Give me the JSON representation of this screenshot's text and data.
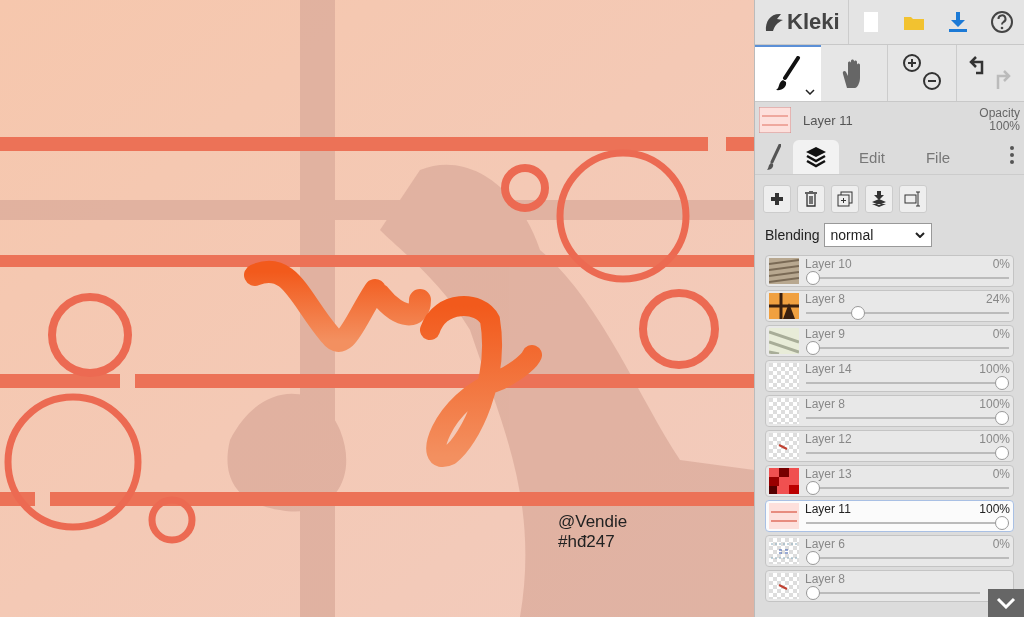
{
  "canvas": {
    "signature": "@Vendie",
    "tag": "#hđ247"
  },
  "app": {
    "name": "Kleki"
  },
  "tools": [
    {
      "kind": "brush",
      "selected": true
    },
    {
      "kind": "hand",
      "selected": false
    }
  ],
  "current_layer": {
    "name": "Layer 11",
    "opacity_label": "Opacity",
    "opacity": "100%"
  },
  "tabs": [
    {
      "kind": "brush",
      "selected": false
    },
    {
      "kind": "layers",
      "selected": true
    },
    {
      "kind": "text",
      "label": "Edit",
      "selected": false
    },
    {
      "kind": "text",
      "label": "File",
      "selected": false
    }
  ],
  "blending": {
    "label": "Blending",
    "value": "normal"
  },
  "layers": [
    {
      "name": "Layer 10",
      "opacity": "0%",
      "level": 0,
      "selected": false
    },
    {
      "name": "Layer 8",
      "opacity": "24%",
      "level": 0.24,
      "selected": false
    },
    {
      "name": "Layer 9",
      "opacity": "0%",
      "level": 0,
      "selected": false
    },
    {
      "name": "Layer 14",
      "opacity": "100%",
      "level": 1,
      "selected": false
    },
    {
      "name": "Layer 8",
      "opacity": "100%",
      "level": 1,
      "selected": false
    },
    {
      "name": "Layer 12",
      "opacity": "100%",
      "level": 1,
      "selected": false
    },
    {
      "name": "Layer 13",
      "opacity": "0%",
      "level": 0,
      "selected": false
    },
    {
      "name": "Layer 11",
      "opacity": "100%",
      "level": 1,
      "selected": true
    },
    {
      "name": "Layer 6",
      "opacity": "0%",
      "level": 0,
      "selected": false
    },
    {
      "name": "Layer 8",
      "level": 0,
      "selected": false
    }
  ]
}
